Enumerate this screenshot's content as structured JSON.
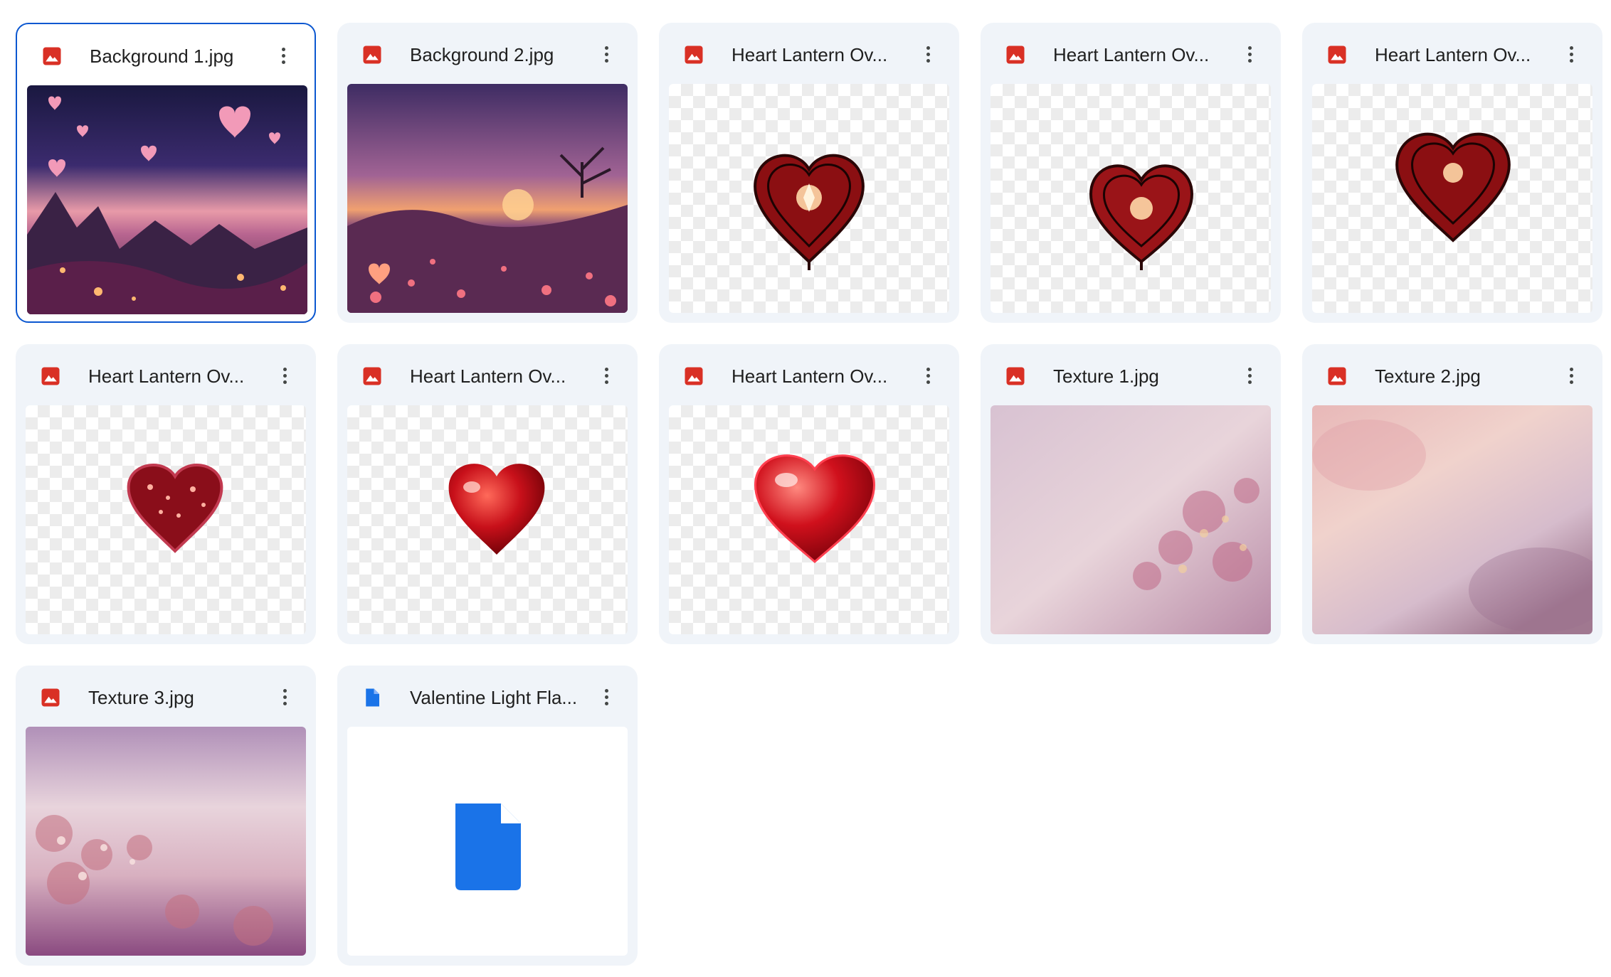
{
  "colors": {
    "image_icon": "#d93025",
    "doc_icon": "#1a73e8",
    "card_bg": "#f0f4f9",
    "selected_border": "#0b57d0"
  },
  "files": [
    {
      "name": "Background 1.jpg",
      "icon": "image-icon",
      "preview": "night-sky-heart-balloons",
      "selected": true
    },
    {
      "name": "Background 2.jpg",
      "icon": "image-icon",
      "preview": "sunset-field-heart-lanterns",
      "selected": false
    },
    {
      "name": "Heart Lantern Ov...",
      "icon": "image-icon",
      "preview": "ornate-heart-lantern",
      "selected": false
    },
    {
      "name": "Heart Lantern Ov...",
      "icon": "image-icon",
      "preview": "ornate-heart-lantern",
      "selected": false
    },
    {
      "name": "Heart Lantern Ov...",
      "icon": "image-icon",
      "preview": "ornate-heart-lantern",
      "selected": false
    },
    {
      "name": "Heart Lantern Ov...",
      "icon": "image-icon",
      "preview": "glowing-heart-balloon",
      "selected": false
    },
    {
      "name": "Heart Lantern Ov...",
      "icon": "image-icon",
      "preview": "red-foil-heart-balloon",
      "selected": false
    },
    {
      "name": "Heart Lantern Ov...",
      "icon": "image-icon",
      "preview": "red-glass-heart",
      "selected": false
    },
    {
      "name": "Texture 1.jpg",
      "icon": "image-icon",
      "preview": "floral-pink-texture",
      "selected": false
    },
    {
      "name": "Texture 2.jpg",
      "icon": "image-icon",
      "preview": "soft-pink-texture",
      "selected": false
    },
    {
      "name": "Texture 3.jpg",
      "icon": "image-icon",
      "preview": "floral-purple-texture",
      "selected": false
    },
    {
      "name": "Valentine Light Fla...",
      "icon": "doc-icon",
      "preview": "document",
      "selected": false
    }
  ]
}
